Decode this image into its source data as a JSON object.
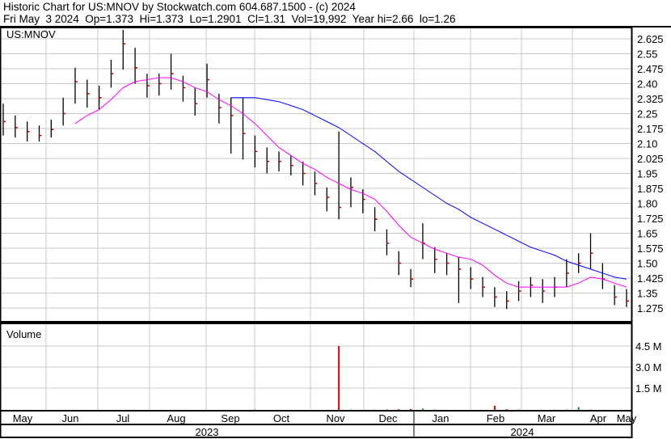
{
  "header": {
    "title": "Historic Chart for US:MNOV by Stockwatch.com 604.687.1500 - (c) 2024",
    "quote": "Fri May  3 2024  Op=1.373  Hi=1.373  Lo=1.2901  Cl=1.31  Vol=19,992  Year hi=2.66  lo=1.26"
  },
  "chart_data": {
    "type": "ohlc",
    "symbol_label": "US:MNOV",
    "volume_label": "Volume",
    "price_ticks": [
      "2.625",
      "2.55",
      "2.475",
      "2.40",
      "2.325",
      "2.25",
      "2.175",
      "2.10",
      "2.025",
      "1.95",
      "1.875",
      "1.80",
      "1.725",
      "1.65",
      "1.575",
      "1.50",
      "1.425",
      "1.35",
      "1.275"
    ],
    "ylim": [
      1.275,
      2.625
    ],
    "volume_ticks": [
      "4.5 M",
      "3.0 M",
      "1.5 M"
    ],
    "volume_ylim": [
      0,
      4.5
    ],
    "months": [
      "May",
      "Jun",
      "Jul",
      "Aug",
      "Sep",
      "Oct",
      "Nov",
      "Dec",
      "Jan",
      "Feb",
      "Mar",
      "Apr",
      "May"
    ],
    "years": [
      "2023",
      "2024"
    ],
    "weeks": 53,
    "close": [
      2.21,
      2.18,
      2.16,
      2.14,
      2.17,
      2.25,
      2.41,
      2.35,
      2.33,
      2.45,
      2.6,
      2.48,
      2.39,
      2.4,
      2.45,
      2.38,
      2.3,
      2.42,
      2.28,
      2.24,
      2.15,
      2.06,
      2.01,
      2.01,
      1.99,
      1.95,
      1.9,
      1.83,
      1.78,
      1.88,
      1.82,
      1.72,
      1.6,
      1.5,
      1.42,
      1.6,
      1.52,
      1.5,
      1.47,
      1.42,
      1.38,
      1.33,
      1.31,
      1.36,
      1.39,
      1.36,
      1.38,
      1.45,
      1.5,
      1.55,
      1.42,
      1.33,
      1.31
    ],
    "high": [
      2.3,
      2.24,
      2.21,
      2.19,
      2.22,
      2.33,
      2.48,
      2.42,
      2.39,
      2.52,
      2.67,
      2.58,
      2.45,
      2.45,
      2.55,
      2.44,
      2.38,
      2.5,
      2.35,
      2.33,
      2.33,
      2.14,
      2.08,
      2.06,
      2.04,
      2.01,
      1.96,
      1.88,
      2.16,
      1.93,
      1.87,
      1.78,
      1.67,
      1.56,
      1.47,
      1.7,
      1.58,
      1.55,
      1.53,
      1.48,
      1.43,
      1.38,
      1.36,
      1.41,
      1.43,
      1.42,
      1.43,
      1.52,
      1.55,
      1.65,
      1.5,
      1.39,
      1.37
    ],
    "low": [
      2.14,
      2.13,
      2.11,
      2.11,
      2.13,
      2.19,
      2.3,
      2.28,
      2.27,
      2.38,
      2.47,
      2.4,
      2.33,
      2.34,
      2.37,
      2.31,
      2.24,
      2.33,
      2.2,
      2.05,
      2.02,
      1.98,
      1.95,
      1.96,
      1.94,
      1.89,
      1.84,
      1.76,
      1.72,
      1.78,
      1.75,
      1.66,
      1.54,
      1.44,
      1.38,
      1.52,
      1.45,
      1.44,
      1.3,
      1.37,
      1.33,
      1.28,
      1.27,
      1.31,
      1.33,
      1.3,
      1.33,
      1.38,
      1.45,
      1.47,
      1.37,
      1.29,
      1.28
    ],
    "ma_short": [
      null,
      null,
      null,
      null,
      null,
      null,
      2.2,
      2.24,
      2.27,
      2.32,
      2.38,
      2.41,
      2.42,
      2.43,
      2.43,
      2.41,
      2.38,
      2.36,
      2.32,
      2.29,
      2.25,
      2.2,
      2.14,
      2.08,
      2.04,
      2.0,
      1.97,
      1.93,
      1.9,
      1.87,
      1.85,
      1.82,
      1.76,
      1.69,
      1.63,
      1.6,
      1.57,
      1.55,
      1.53,
      1.52,
      1.49,
      1.44,
      1.4,
      1.38,
      1.38,
      1.38,
      1.38,
      1.38,
      1.4,
      1.43,
      1.42,
      1.4,
      1.38
    ],
    "ma_long": [
      null,
      null,
      null,
      null,
      null,
      null,
      null,
      null,
      null,
      null,
      null,
      null,
      null,
      null,
      null,
      null,
      null,
      null,
      null,
      2.33,
      2.33,
      2.33,
      2.32,
      2.31,
      2.29,
      2.27,
      2.24,
      2.21,
      2.18,
      2.14,
      2.1,
      2.06,
      2.01,
      1.96,
      1.92,
      1.88,
      1.84,
      1.8,
      1.77,
      1.73,
      1.7,
      1.67,
      1.64,
      1.61,
      1.58,
      1.56,
      1.54,
      1.51,
      1.49,
      1.47,
      1.45,
      1.43,
      1.42
    ],
    "volume_m": [
      0.02,
      0.02,
      0.02,
      0.02,
      0.03,
      0.03,
      0.05,
      0.02,
      0.03,
      0.02,
      0.02,
      0.02,
      0.02,
      0.02,
      0.02,
      0.02,
      0.04,
      0.02,
      0.02,
      0.02,
      0.02,
      0.08,
      0.05,
      0.03,
      0.02,
      0.02,
      0.02,
      0.03,
      4.5,
      0.08,
      0.06,
      0.07,
      0.08,
      0.1,
      0.12,
      0.15,
      0.08,
      0.06,
      0.05,
      0.05,
      0.06,
      0.35,
      0.1,
      0.08,
      0.05,
      0.06,
      0.07,
      0.08,
      0.25,
      0.08,
      0.06,
      0.04,
      0.03
    ],
    "colors": {
      "bar": "#000000",
      "close_tick": "#c00000",
      "ma_short": "#ff00ff",
      "ma_long": "#0000ff",
      "vol_up": "#00a000",
      "vol_down": "#e00000",
      "grid": "#c8c8c8"
    }
  }
}
